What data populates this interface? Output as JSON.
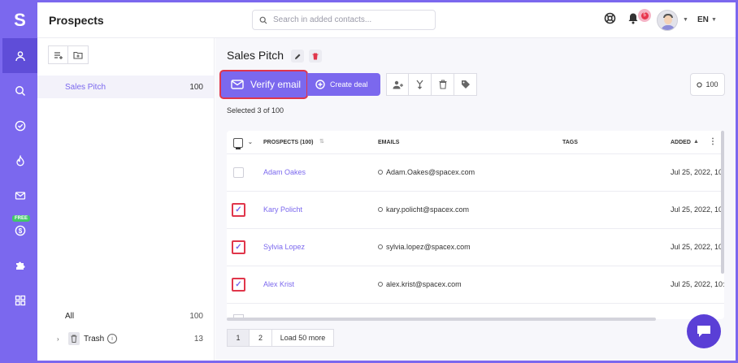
{
  "app": {
    "logo_letter": "S",
    "title": "Prospects"
  },
  "search": {
    "placeholder": "Search in added contacts..."
  },
  "topbar": {
    "notification_count": "5",
    "language": "EN"
  },
  "sidebar_nav": {
    "items": [
      {
        "icon": "user-icon",
        "active": true
      },
      {
        "icon": "search-icon",
        "active": false
      },
      {
        "icon": "check-circle-icon",
        "active": false
      },
      {
        "icon": "flame-icon",
        "active": false
      },
      {
        "icon": "mail-icon",
        "active": false
      },
      {
        "icon": "dollar-icon",
        "active": false,
        "badge": "FREE"
      },
      {
        "icon": "puzzle-icon",
        "active": false
      },
      {
        "icon": "apps-icon",
        "active": false
      }
    ]
  },
  "lists_panel": {
    "items": [
      {
        "name": "Sales Pitch",
        "count": "100"
      }
    ],
    "all": {
      "name": "All",
      "count": "100"
    },
    "trash": {
      "name": "Trash",
      "count": "13"
    }
  },
  "main": {
    "list_title": "Sales Pitch",
    "verify_label": "Verify email",
    "create_deal_label": "Create deal",
    "count_pill": "100",
    "selected_text": "Selected 3 of 100"
  },
  "table": {
    "headers": {
      "prospects": "PROSPECTS (100)",
      "emails": "EMAILS",
      "tags": "TAGS",
      "added": "ADDED"
    },
    "rows": [
      {
        "name": "Adam Oakes",
        "email": "Adam.Oakes@spacex.com",
        "added": "Jul 25, 2022, 10:",
        "checked": false
      },
      {
        "name": "Kary Policht",
        "email": "kary.policht@spacex.com",
        "added": "Jul 25, 2022, 10:",
        "checked": true
      },
      {
        "name": "Sylvia Lopez",
        "email": "sylvia.lopez@spacex.com",
        "added": "Jul 25, 2022, 10:",
        "checked": true
      },
      {
        "name": "Alex Krist",
        "email": "alex.krist@spacex.com",
        "added": "Jul 25, 2022, 10:",
        "checked": true
      }
    ]
  },
  "pagination": {
    "page1": "1",
    "page2": "2",
    "load_more": "Load 50 more"
  },
  "colors": {
    "brand": "#7b68ee",
    "highlight": "#e0364b"
  }
}
